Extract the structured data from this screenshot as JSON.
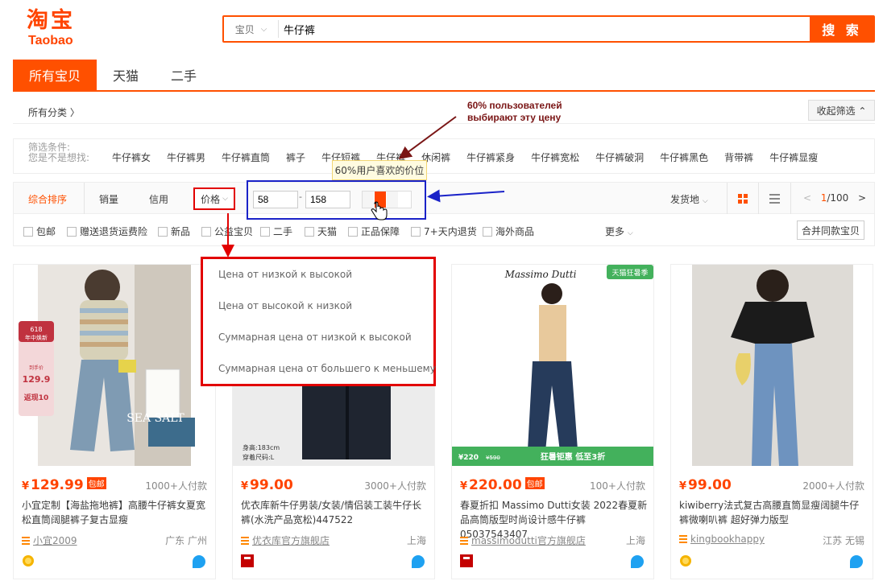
{
  "logo": {
    "cn": "淘宝",
    "en": "Taobao"
  },
  "search": {
    "scope": "宝贝",
    "query": "牛仔裤",
    "button": "搜 索"
  },
  "tabs": [
    "所有宝贝",
    "天猫",
    "二手"
  ],
  "crumb": {
    "all": "所有分类 〉",
    "collapse": "收起筛选 ⌃"
  },
  "annotation_top": {
    "line1": "60% пользователей",
    "line2": "выбирают эту цену"
  },
  "suggest": {
    "label1": "筛选条件:",
    "label2": "您是不是想找:",
    "words": [
      "牛仔裤女",
      "牛仔裤男",
      "牛仔裤直筒",
      "裤子",
      "牛仔短裤",
      "牛仔裤",
      "休闲裤",
      "牛仔裤紧身",
      "牛仔裤宽松",
      "牛仔裤破洞",
      "牛仔裤黑色",
      "背带裤",
      "牛仔裤显瘦"
    ]
  },
  "tooltip": "60%用户喜欢的价位",
  "sort": {
    "composite": "综合排序",
    "sales": "销量",
    "credit": "信用",
    "price": "价格",
    "min": "58",
    "max": "158",
    "dash": "-",
    "ship_from": "发货地",
    "page_current": "1",
    "page_total": "/100"
  },
  "filters": [
    "包邮",
    "赠送退货运费险",
    "新品",
    "公益宝贝",
    "二手",
    "天猫",
    "正品保障",
    "7+天内退货",
    "海外商品"
  ],
  "more": "更多",
  "merge": "合并同款宝贝",
  "dropdown": [
    "Цена от низкой к высокой",
    "Цена от высокой к низкой",
    "Суммарная цена от низкой к высокой",
    "Суммарная цена от большего к меньшему"
  ],
  "products": [
    {
      "price": "129.99",
      "tag": "包邮",
      "paid": "1000+人付款",
      "title": "小宜定制【海盐拖地裤】高腰牛仔裤女夏宽松直筒阔腿裤子复古显瘦",
      "shop": "小宜2009",
      "loc": "广东 广州"
    },
    {
      "price": "99.00",
      "tag": "",
      "paid": "3000+人付款",
      "title": "优衣库新牛仔男装/女装/情侣装工装牛仔长裤(水洗产品宽松)447522",
      "shop": "优衣库官方旗舰店",
      "loc": "上海"
    },
    {
      "price": "220.00",
      "tag": "包邮",
      "paid": "100+人付款",
      "title": "春夏折扣 Massimo Dutti女装 2022春夏新品高筒版型时尚设计感牛仔裤 05037543407",
      "shop": "massimodutti官方旗舰店",
      "loc": "上海"
    },
    {
      "price": "99.00",
      "tag": "",
      "paid": "2000+人付款",
      "title": "kiwiberry法式复古高腰直筒显瘦阔腿牛仔裤微喇叭裤 超好弹力版型",
      "shop": "kingbookhappy",
      "loc": "江苏 无锡"
    }
  ],
  "promo1": {
    "line1": "618",
    "line2": "年中焕新",
    "line3": "到手价",
    "price": "129.9",
    "line4": "返现10",
    "brand": "SEA SALT"
  },
  "promo2": {
    "height": "身高:183cm",
    "size": "穿着尺码:L"
  },
  "promo3": {
    "brand": "Massimo Dutti",
    "corner": "天猫狂暑季",
    "band_price": "220",
    "band_old": "590",
    "band_text": "狂暑钜惠 低至3折"
  },
  "colors": {
    "accent": "#ff5000",
    "price": "#ff4400",
    "annot_red": "#e20000",
    "annot_blue": "#1a22c8"
  }
}
